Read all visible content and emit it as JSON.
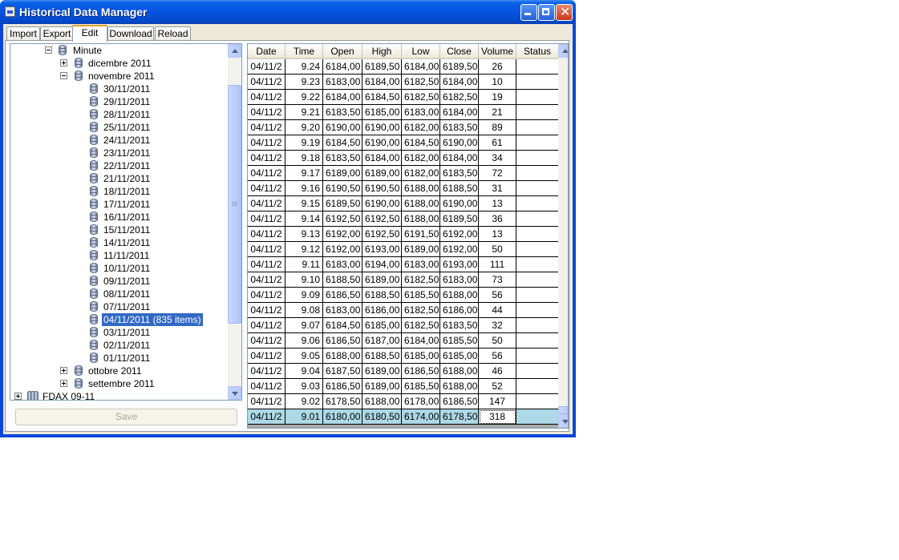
{
  "window": {
    "title": "Historical Data Manager"
  },
  "tabs": [
    {
      "label": "Import"
    },
    {
      "label": "Export"
    },
    {
      "label": "Edit"
    },
    {
      "label": "Download"
    },
    {
      "label": "Reload"
    }
  ],
  "tree": {
    "root": "Minute",
    "months": {
      "dicembre": "dicembre 2011",
      "novembre": "novembre 2011",
      "ottobre": "ottobre 2011",
      "settembre": "settembre 2011"
    },
    "days": [
      "30/11/2011",
      "29/11/2011",
      "28/11/2011",
      "25/11/2011",
      "24/11/2011",
      "23/11/2011",
      "22/11/2011",
      "21/11/2011",
      "18/11/2011",
      "17/11/2011",
      "16/11/2011",
      "15/11/2011",
      "14/11/2011",
      "11/11/2011",
      "10/11/2011",
      "09/11/2011",
      "08/11/2011",
      "07/11/2011",
      "04/11/2011 (835 items)",
      "03/11/2011",
      "02/11/2011",
      "01/11/2011"
    ],
    "selected_day": "04/11/2011 (835 items)",
    "next_symbol": "FDAX 09-11"
  },
  "save_label": "Save",
  "grid": {
    "columns": [
      "Date",
      "Time",
      "Open",
      "High",
      "Low",
      "Close",
      "Volume",
      "Status"
    ],
    "rows": [
      [
        "04/11/2",
        "9.24",
        "6184,00",
        "6189,50",
        "6184,00",
        "6189,50",
        "26",
        ""
      ],
      [
        "04/11/2",
        "9.23",
        "6183,00",
        "6184,00",
        "6182,50",
        "6184,00",
        "10",
        ""
      ],
      [
        "04/11/2",
        "9.22",
        "6184,00",
        "6184,50",
        "6182,50",
        "6182,50",
        "19",
        ""
      ],
      [
        "04/11/2",
        "9.21",
        "6183,50",
        "6185,00",
        "6183,00",
        "6184,00",
        "21",
        ""
      ],
      [
        "04/11/2",
        "9.20",
        "6190,00",
        "6190,00",
        "6182,00",
        "6183,50",
        "89",
        ""
      ],
      [
        "04/11/2",
        "9.19",
        "6184,50",
        "6190,00",
        "6184,50",
        "6190,00",
        "61",
        ""
      ],
      [
        "04/11/2",
        "9.18",
        "6183,50",
        "6184,00",
        "6182,00",
        "6184,00",
        "34",
        ""
      ],
      [
        "04/11/2",
        "9.17",
        "6189,00",
        "6189,00",
        "6182,00",
        "6183,50",
        "72",
        ""
      ],
      [
        "04/11/2",
        "9.16",
        "6190,50",
        "6190,50",
        "6188,00",
        "6188,50",
        "31",
        ""
      ],
      [
        "04/11/2",
        "9.15",
        "6189,50",
        "6190,00",
        "6188,00",
        "6190,00",
        "13",
        ""
      ],
      [
        "04/11/2",
        "9.14",
        "6192,50",
        "6192,50",
        "6188,00",
        "6189,50",
        "36",
        ""
      ],
      [
        "04/11/2",
        "9.13",
        "6192,00",
        "6192,50",
        "6191,50",
        "6192,00",
        "13",
        ""
      ],
      [
        "04/11/2",
        "9.12",
        "6192,00",
        "6193,00",
        "6189,00",
        "6192,00",
        "50",
        ""
      ],
      [
        "04/11/2",
        "9.11",
        "6183,00",
        "6194,00",
        "6183,00",
        "6193,00",
        "111",
        ""
      ],
      [
        "04/11/2",
        "9.10",
        "6188,50",
        "6189,00",
        "6182,50",
        "6183,00",
        "73",
        ""
      ],
      [
        "04/11/2",
        "9.09",
        "6186,50",
        "6188,50",
        "6185,50",
        "6188,00",
        "56",
        ""
      ],
      [
        "04/11/2",
        "9.08",
        "6183,00",
        "6186,00",
        "6182,50",
        "6186,00",
        "44",
        ""
      ],
      [
        "04/11/2",
        "9.07",
        "6184,50",
        "6185,00",
        "6182,50",
        "6183,50",
        "32",
        ""
      ],
      [
        "04/11/2",
        "9.06",
        "6186,50",
        "6187,00",
        "6184,00",
        "6185,50",
        "50",
        ""
      ],
      [
        "04/11/2",
        "9.05",
        "6188,00",
        "6188,50",
        "6185,00",
        "6185,00",
        "56",
        ""
      ],
      [
        "04/11/2",
        "9.04",
        "6187,50",
        "6189,00",
        "6186,50",
        "6188,00",
        "46",
        ""
      ],
      [
        "04/11/2",
        "9.03",
        "6186,50",
        "6189,00",
        "6185,50",
        "6188,00",
        "52",
        ""
      ],
      [
        "04/11/2",
        "9.02",
        "6178,50",
        "6188,00",
        "6178,00",
        "6186,50",
        "147",
        ""
      ],
      [
        "04/11/2",
        "9.01",
        "6180,00",
        "6180,50",
        "6174,00",
        "6178,50",
        "318",
        ""
      ]
    ],
    "selected_row_index": 23
  },
  "colors": {
    "title_bar": "#0554e0",
    "selection": "#316ac5",
    "selected_row": "#add8e6"
  }
}
